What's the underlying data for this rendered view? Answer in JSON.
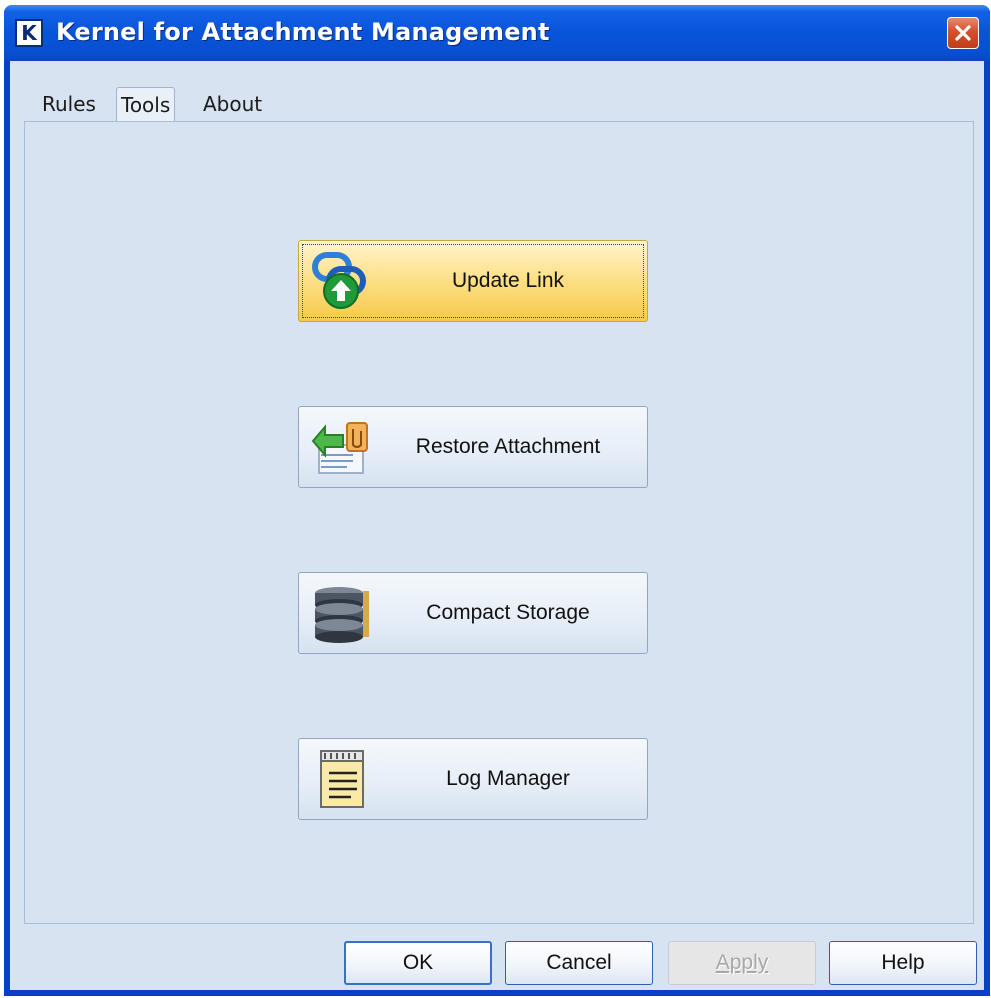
{
  "window": {
    "title": "Kernel for Attachment Management",
    "app_icon_letter": "K"
  },
  "tabs": [
    {
      "label": "Rules",
      "active": false
    },
    {
      "label": "Tools",
      "active": true
    },
    {
      "label": "About",
      "active": false
    }
  ],
  "tools": {
    "update_link": {
      "label": "Update Link",
      "icon": "link-upload-icon",
      "state": "hot"
    },
    "restore_attachment": {
      "label": "Restore Attachment",
      "icon": "restore-attachment-icon"
    },
    "compact_storage": {
      "label": "Compact Storage",
      "icon": "storage-stack-icon"
    },
    "log_manager": {
      "label": "Log Manager",
      "icon": "notepad-icon"
    }
  },
  "footer": {
    "ok_label": "OK",
    "cancel_label": "Cancel",
    "apply_label": "Apply",
    "apply_enabled": false,
    "help_label": "Help"
  },
  "colors": {
    "titlebar": "#0a4fd1",
    "dialog_bg": "#d7e3f1",
    "hot_button": "#fde18a",
    "close_button": "#d4502e"
  }
}
